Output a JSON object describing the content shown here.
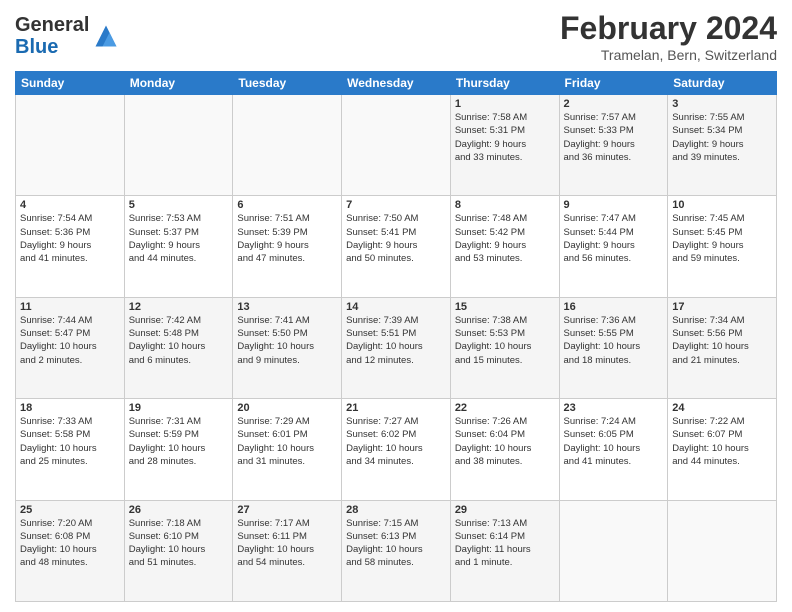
{
  "logo": {
    "line1": "General",
    "line2": "Blue"
  },
  "title": "February 2024",
  "location": "Tramelan, Bern, Switzerland",
  "days_of_week": [
    "Sunday",
    "Monday",
    "Tuesday",
    "Wednesday",
    "Thursday",
    "Friday",
    "Saturday"
  ],
  "weeks": [
    [
      {
        "day": "",
        "info": ""
      },
      {
        "day": "",
        "info": ""
      },
      {
        "day": "",
        "info": ""
      },
      {
        "day": "",
        "info": ""
      },
      {
        "day": "1",
        "info": "Sunrise: 7:58 AM\nSunset: 5:31 PM\nDaylight: 9 hours\nand 33 minutes."
      },
      {
        "day": "2",
        "info": "Sunrise: 7:57 AM\nSunset: 5:33 PM\nDaylight: 9 hours\nand 36 minutes."
      },
      {
        "day": "3",
        "info": "Sunrise: 7:55 AM\nSunset: 5:34 PM\nDaylight: 9 hours\nand 39 minutes."
      }
    ],
    [
      {
        "day": "4",
        "info": "Sunrise: 7:54 AM\nSunset: 5:36 PM\nDaylight: 9 hours\nand 41 minutes."
      },
      {
        "day": "5",
        "info": "Sunrise: 7:53 AM\nSunset: 5:37 PM\nDaylight: 9 hours\nand 44 minutes."
      },
      {
        "day": "6",
        "info": "Sunrise: 7:51 AM\nSunset: 5:39 PM\nDaylight: 9 hours\nand 47 minutes."
      },
      {
        "day": "7",
        "info": "Sunrise: 7:50 AM\nSunset: 5:41 PM\nDaylight: 9 hours\nand 50 minutes."
      },
      {
        "day": "8",
        "info": "Sunrise: 7:48 AM\nSunset: 5:42 PM\nDaylight: 9 hours\nand 53 minutes."
      },
      {
        "day": "9",
        "info": "Sunrise: 7:47 AM\nSunset: 5:44 PM\nDaylight: 9 hours\nand 56 minutes."
      },
      {
        "day": "10",
        "info": "Sunrise: 7:45 AM\nSunset: 5:45 PM\nDaylight: 9 hours\nand 59 minutes."
      }
    ],
    [
      {
        "day": "11",
        "info": "Sunrise: 7:44 AM\nSunset: 5:47 PM\nDaylight: 10 hours\nand 2 minutes."
      },
      {
        "day": "12",
        "info": "Sunrise: 7:42 AM\nSunset: 5:48 PM\nDaylight: 10 hours\nand 6 minutes."
      },
      {
        "day": "13",
        "info": "Sunrise: 7:41 AM\nSunset: 5:50 PM\nDaylight: 10 hours\nand 9 minutes."
      },
      {
        "day": "14",
        "info": "Sunrise: 7:39 AM\nSunset: 5:51 PM\nDaylight: 10 hours\nand 12 minutes."
      },
      {
        "day": "15",
        "info": "Sunrise: 7:38 AM\nSunset: 5:53 PM\nDaylight: 10 hours\nand 15 minutes."
      },
      {
        "day": "16",
        "info": "Sunrise: 7:36 AM\nSunset: 5:55 PM\nDaylight: 10 hours\nand 18 minutes."
      },
      {
        "day": "17",
        "info": "Sunrise: 7:34 AM\nSunset: 5:56 PM\nDaylight: 10 hours\nand 21 minutes."
      }
    ],
    [
      {
        "day": "18",
        "info": "Sunrise: 7:33 AM\nSunset: 5:58 PM\nDaylight: 10 hours\nand 25 minutes."
      },
      {
        "day": "19",
        "info": "Sunrise: 7:31 AM\nSunset: 5:59 PM\nDaylight: 10 hours\nand 28 minutes."
      },
      {
        "day": "20",
        "info": "Sunrise: 7:29 AM\nSunset: 6:01 PM\nDaylight: 10 hours\nand 31 minutes."
      },
      {
        "day": "21",
        "info": "Sunrise: 7:27 AM\nSunset: 6:02 PM\nDaylight: 10 hours\nand 34 minutes."
      },
      {
        "day": "22",
        "info": "Sunrise: 7:26 AM\nSunset: 6:04 PM\nDaylight: 10 hours\nand 38 minutes."
      },
      {
        "day": "23",
        "info": "Sunrise: 7:24 AM\nSunset: 6:05 PM\nDaylight: 10 hours\nand 41 minutes."
      },
      {
        "day": "24",
        "info": "Sunrise: 7:22 AM\nSunset: 6:07 PM\nDaylight: 10 hours\nand 44 minutes."
      }
    ],
    [
      {
        "day": "25",
        "info": "Sunrise: 7:20 AM\nSunset: 6:08 PM\nDaylight: 10 hours\nand 48 minutes."
      },
      {
        "day": "26",
        "info": "Sunrise: 7:18 AM\nSunset: 6:10 PM\nDaylight: 10 hours\nand 51 minutes."
      },
      {
        "day": "27",
        "info": "Sunrise: 7:17 AM\nSunset: 6:11 PM\nDaylight: 10 hours\nand 54 minutes."
      },
      {
        "day": "28",
        "info": "Sunrise: 7:15 AM\nSunset: 6:13 PM\nDaylight: 10 hours\nand 58 minutes."
      },
      {
        "day": "29",
        "info": "Sunrise: 7:13 AM\nSunset: 6:14 PM\nDaylight: 11 hours\nand 1 minute."
      },
      {
        "day": "",
        "info": ""
      },
      {
        "day": "",
        "info": ""
      }
    ]
  ]
}
